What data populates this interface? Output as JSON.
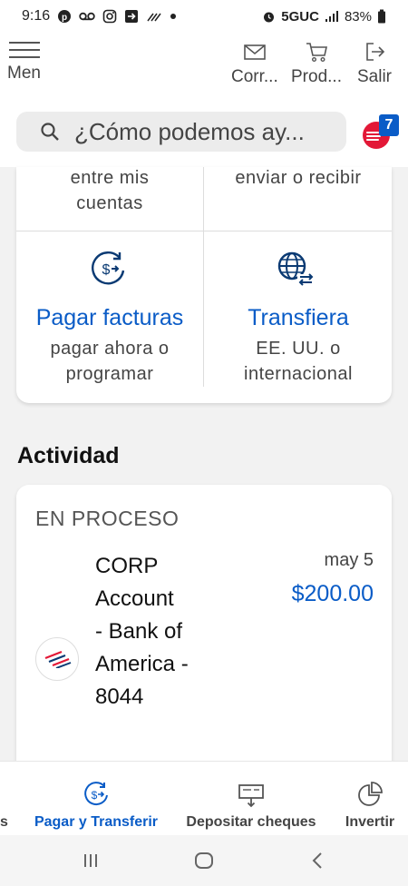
{
  "status_bar": {
    "time": "9:16",
    "network": "5GUC",
    "battery": "83%",
    "icons": [
      "pinterest-icon",
      "voicemail-icon",
      "instagram-icon",
      "exit-app-icon",
      "wifi-calling-icon",
      "dot-icon",
      "alarm-icon",
      "signal-icon",
      "battery-icon"
    ]
  },
  "header": {
    "menu_label": "Men",
    "mail_label": "Corr...",
    "products_label": "Prod...",
    "logout_label": "Salir"
  },
  "search": {
    "placeholder": "¿Cómo podemos ay...",
    "assistant_badge": "7"
  },
  "action_card": {
    "top_left_sub": [
      "entre mis",
      "cuentas"
    ],
    "top_right_sub": [
      "enviar o recibir"
    ],
    "pay_bills": {
      "title": "Pagar facturas",
      "sub": [
        "pagar ahora o",
        "programar"
      ],
      "icon": "dollar-transfer-icon"
    },
    "transfer": {
      "title": "Transfiera",
      "sub": [
        "EE. UU. o",
        "internacional"
      ],
      "icon": "globe-transfer-icon"
    }
  },
  "activity": {
    "heading": "Actividad",
    "pending_label": "EN PROCESO",
    "transactions": [
      {
        "description_lines": [
          "CORP",
          "Account",
          "- Bank of",
          "America -",
          "8044"
        ],
        "date": "may 5",
        "amount": "$200.00"
      }
    ]
  },
  "bottom_nav": {
    "partial_label": "s",
    "items": [
      {
        "label": "Pagar y Transferir",
        "icon": "dollar-transfer-icon",
        "active": true
      },
      {
        "label": "Depositar cheques",
        "icon": "check-deposit-icon",
        "active": false
      },
      {
        "label": "Invertir",
        "icon": "pie-chart-icon",
        "active": false
      }
    ]
  },
  "colors": {
    "brand_blue": "#0a5cc7",
    "brand_red": "#e31837",
    "background": "#f2f2f2"
  }
}
